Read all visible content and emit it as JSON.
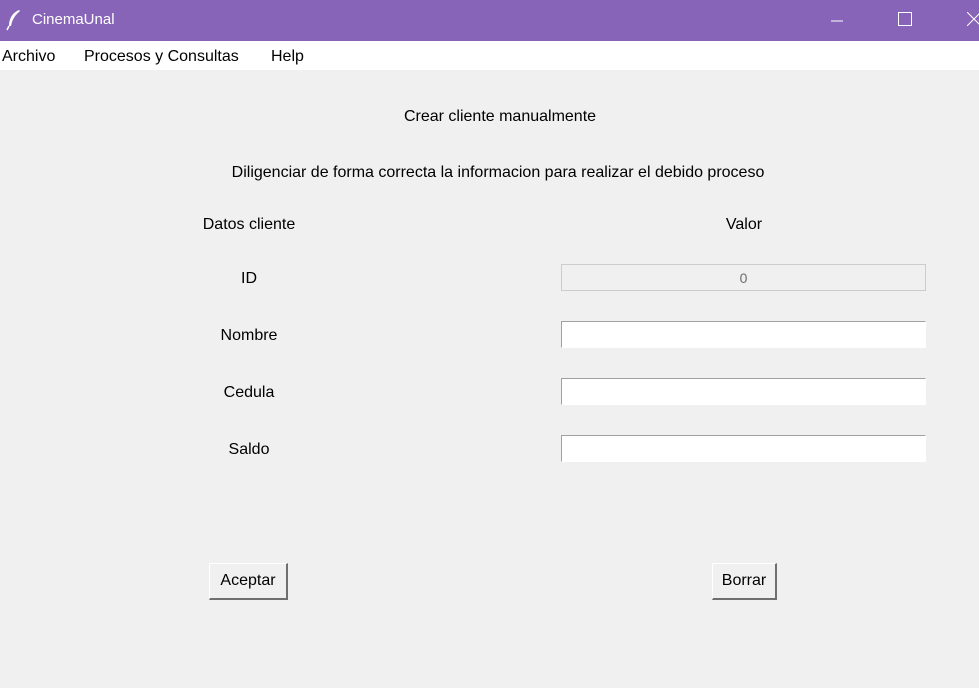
{
  "window": {
    "title": "CinemaUnal",
    "icon": "feather-icon",
    "accent": "#8764b8"
  },
  "menubar": {
    "items": [
      "Archivo",
      "Procesos y Consultas",
      "Help"
    ]
  },
  "form": {
    "title": "Crear cliente manualmente",
    "description": "Diligenciar de forma correcta la informacion para realizar el debido proceso",
    "col_left": "Datos cliente",
    "col_right": "Valor",
    "fields": [
      {
        "label": "ID",
        "value": "0",
        "disabled": true
      },
      {
        "label": "Nombre",
        "value": ""
      },
      {
        "label": "Cedula",
        "value": ""
      },
      {
        "label": "Saldo",
        "value": ""
      }
    ]
  },
  "buttons": {
    "accept": "Aceptar",
    "clear": "Borrar"
  }
}
